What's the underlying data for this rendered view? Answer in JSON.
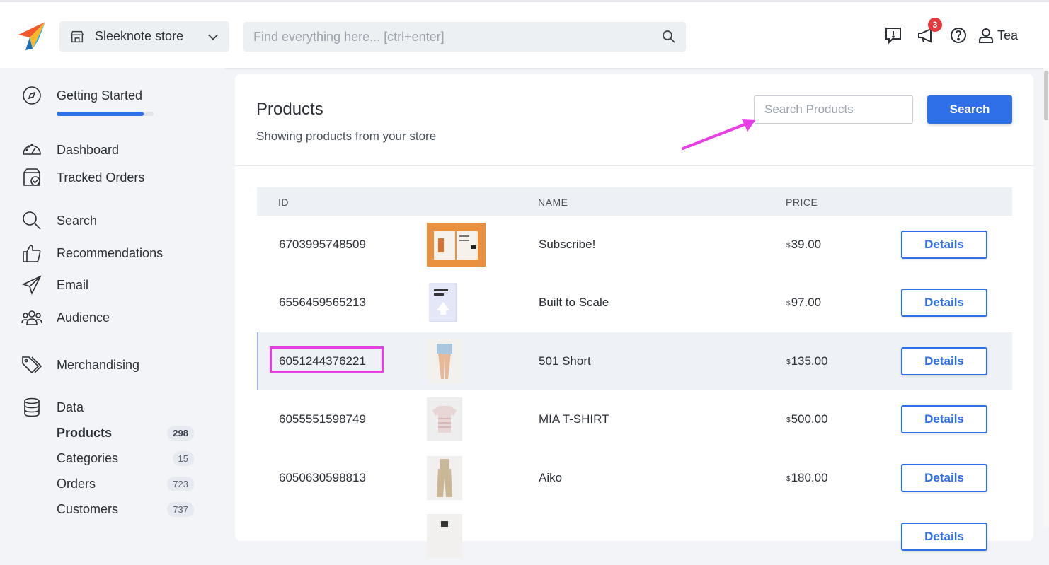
{
  "header": {
    "store_name": "Sleeknote store",
    "global_search_placeholder": "Find everything here... [ctrl+enter]",
    "notification_count": "3",
    "user_name": "Tea"
  },
  "sidebar": {
    "getting_started": "Getting Started",
    "getting_started_progress": 0.9,
    "dashboard": "Dashboard",
    "tracked_orders": "Tracked Orders",
    "search": "Search",
    "recommendations": "Recommendations",
    "email": "Email",
    "audience": "Audience",
    "merchandising": "Merchandising",
    "data": "Data",
    "data_items": [
      {
        "label": "Products",
        "count": "298"
      },
      {
        "label": "Categories",
        "count": "15"
      },
      {
        "label": "Orders",
        "count": "723"
      },
      {
        "label": "Customers",
        "count": "737"
      }
    ]
  },
  "main": {
    "title": "Products",
    "subtitle": "Showing products from your store",
    "search_placeholder": "Search Products",
    "search_button": "Search",
    "columns": {
      "id": "ID",
      "name": "NAME",
      "price": "PRICE"
    },
    "currency": "$",
    "details_label": "Details",
    "rows": [
      {
        "id": "6703995748509",
        "name": "Subscribe!",
        "price": "39.00"
      },
      {
        "id": "6556459565213",
        "name": "Built to Scale",
        "price": "97.00"
      },
      {
        "id": "6051244376221",
        "name": "501 Short",
        "price": "135.00"
      },
      {
        "id": "6055551598749",
        "name": "MIA T-SHIRT",
        "price": "500.00"
      },
      {
        "id": "6050630598813",
        "name": "Aiko",
        "price": "180.00"
      }
    ]
  },
  "colors": {
    "accent": "#2f6fe8",
    "annotation": "#e93ee6",
    "badge": "#e5393c"
  }
}
